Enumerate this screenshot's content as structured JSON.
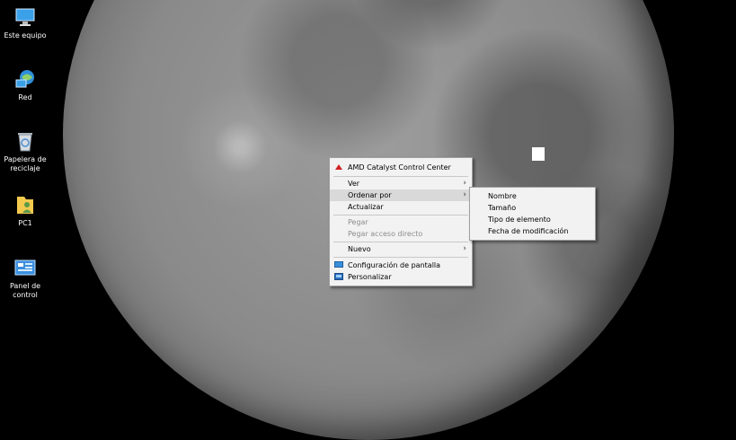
{
  "desktop": {
    "icons": [
      {
        "label": "Este equipo",
        "icon": "computer-icon"
      },
      {
        "label": "Red",
        "icon": "network-icon"
      },
      {
        "label": "Papelera de reciclaje",
        "icon": "recycle-bin-icon"
      },
      {
        "label": "PC1",
        "icon": "user-folder-icon"
      },
      {
        "label": "Panel de control",
        "icon": "control-panel-icon"
      }
    ]
  },
  "context_menu": {
    "items": [
      {
        "label": "AMD Catalyst Control Center",
        "icon": "amd-icon"
      },
      {
        "label": "Ver",
        "has_submenu": true
      },
      {
        "label": "Ordenar por",
        "has_submenu": true,
        "highlighted": true
      },
      {
        "label": "Actualizar"
      },
      {
        "label": "Pegar",
        "disabled": true
      },
      {
        "label": "Pegar acceso directo",
        "disabled": true
      },
      {
        "label": "Nuevo",
        "has_submenu": true
      },
      {
        "label": "Configuración de pantalla",
        "icon": "display-settings-icon"
      },
      {
        "label": "Personalizar",
        "icon": "personalize-icon"
      }
    ],
    "submenu": {
      "items": [
        {
          "label": "Nombre"
        },
        {
          "label": "Tamaño"
        },
        {
          "label": "Tipo de elemento"
        },
        {
          "label": "Fecha de modificación"
        }
      ]
    }
  },
  "colors": {
    "menu_bg": "#f2f2f2",
    "menu_highlight": "#d9d9d9",
    "disabled_text": "#8c8c8c"
  }
}
